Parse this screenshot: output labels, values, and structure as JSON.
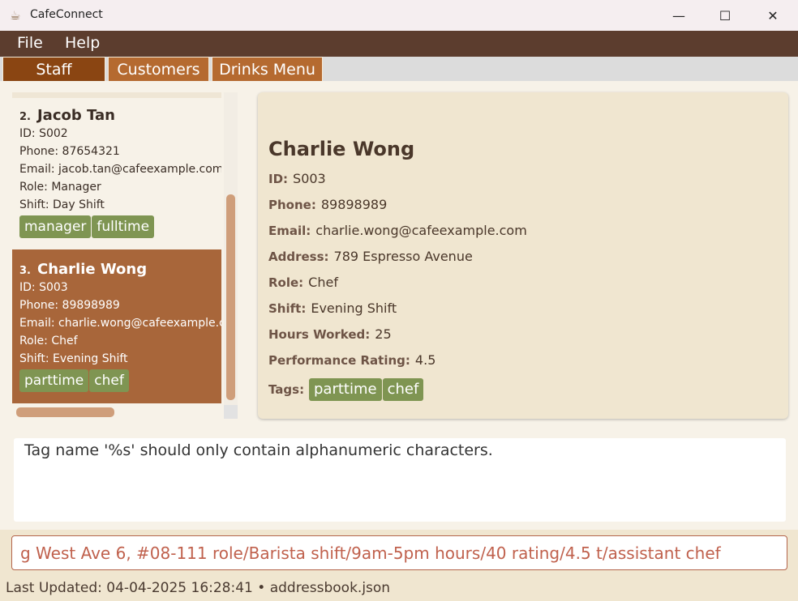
{
  "window": {
    "title": "CafeConnect",
    "icon": "coffee-cup-icon",
    "minimize_glyph": "—",
    "maximize_glyph": "☐",
    "close_glyph": "✕"
  },
  "menu": {
    "file": "File",
    "help": "Help"
  },
  "tabs": [
    {
      "label": "Staff",
      "active": true
    },
    {
      "label": "Customers",
      "active": false
    },
    {
      "label": "Drinks Menu",
      "active": false
    }
  ],
  "list": {
    "cards": [
      {
        "index": "2.",
        "name": "Jacob Tan",
        "id": "ID: S002",
        "phone": "Phone: 87654321",
        "email": "Email: jacob.tan@cafeexample.com",
        "role": "Role: Manager",
        "shift": "Shift: Day Shift",
        "tags": [
          "manager",
          "fulltime"
        ]
      },
      {
        "index": "3.",
        "name": "Charlie Wong",
        "id": "ID: S003",
        "phone": "Phone: 89898989",
        "email": "Email: charlie.wong@cafeexample.com",
        "role": "Role: Chef",
        "shift": "Shift: Evening Shift",
        "tags": [
          "parttime",
          "chef"
        ],
        "selected": true
      }
    ]
  },
  "detail": {
    "name": "Charlie Wong",
    "rows": [
      {
        "label": "ID:",
        "value": "S003"
      },
      {
        "label": "Phone:",
        "value": "89898989"
      },
      {
        "label": "Email:",
        "value": "charlie.wong@cafeexample.com"
      },
      {
        "label": "Address:",
        "value": "789 Espresso Avenue"
      },
      {
        "label": "Role:",
        "value": "Chef"
      },
      {
        "label": "Shift:",
        "value": "Evening Shift"
      },
      {
        "label": "Hours Worked:",
        "value": "25"
      },
      {
        "label": "Performance Rating:",
        "value": "4.5"
      }
    ],
    "tags_label": "Tags:",
    "tags": [
      "parttime",
      "chef"
    ]
  },
  "result": {
    "message": "Tag name '%s' should only contain alphanumeric characters."
  },
  "command": {
    "value": "g West Ave 6, #08-111 role/Barista shift/9am-5pm hours/40 rating/4.5 t/assistant chef"
  },
  "status": {
    "text": "Last Updated: 04-04-2025 16:28:41 • addressbook.json"
  },
  "colors": {
    "menubar": "#5c3d2e",
    "tab_active": "#8a4512",
    "tab_inactive": "#b56a30",
    "selected_card": "#a8663a",
    "tag": "#7f9552",
    "command_text": "#c0614d"
  }
}
